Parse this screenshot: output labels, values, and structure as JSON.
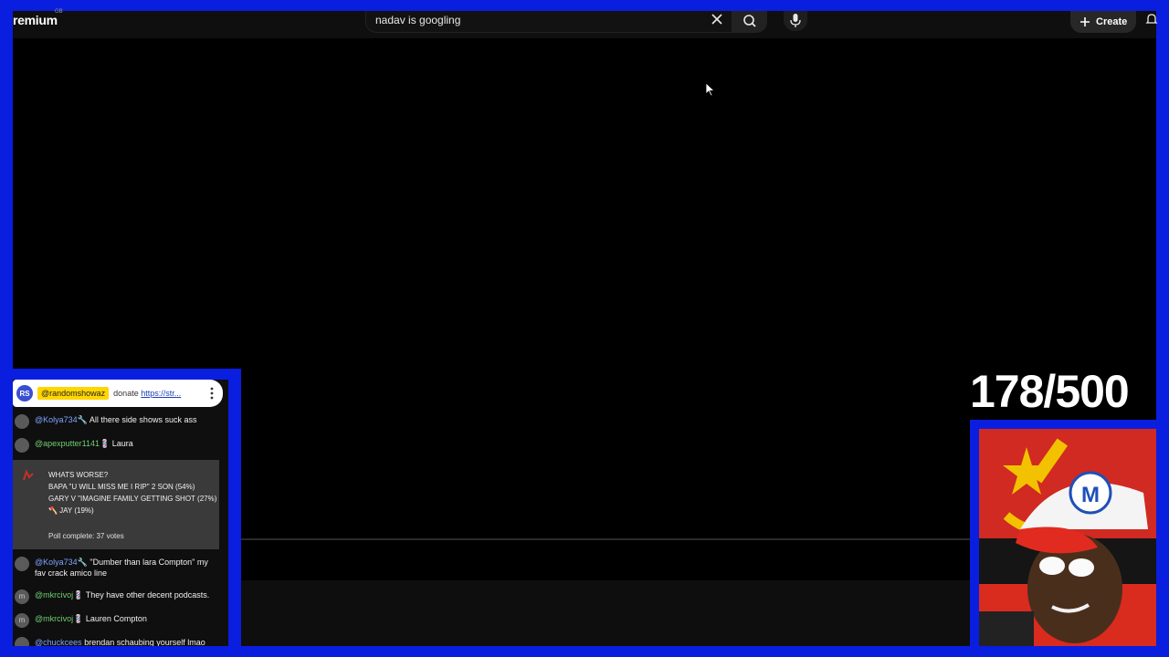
{
  "header": {
    "logo_text": "remium",
    "logo_sup": "GB",
    "search_value": "nadav is googling",
    "create_label": "Create"
  },
  "chat": {
    "pinned": {
      "avatar": "RS",
      "user": "@randomshowaz",
      "message": "donate ",
      "link": "https://str..."
    },
    "messages_top": [
      {
        "avatar": "",
        "user": "@Kolya734",
        "badge": "🔧",
        "text": "All there side shows suck ass"
      },
      {
        "avatar": "",
        "user": "@apexputter1141",
        "badge": "💈",
        "text": "Laura"
      }
    ],
    "poll": {
      "title": "WHATS WORSE?",
      "options": [
        "BAPA \"U WILL MISS ME I RIP\" 2 SON (54%)",
        "GARY V \"IMAGINE FAMILY GETTING SHOT (27%)",
        "🪓 JAY (19%)"
      ],
      "footer": "Poll complete: 37 votes"
    },
    "messages_bottom": [
      {
        "avatar": "",
        "user": "@Kolya734",
        "badge": "🔧",
        "text": "\"Dumber than lara Compton\" my fav crack amico line"
      },
      {
        "avatar": "m",
        "user": "@mkrcivoj",
        "badge": "💈",
        "text": "They have other decent podcasts."
      },
      {
        "avatar": "m",
        "user": "@mkrcivoj",
        "badge": "💈",
        "text": "Lauren Compton"
      },
      {
        "avatar": "",
        "user": "@chuckcees",
        "badge": "",
        "text": "brendan schaubing yourself lmao"
      }
    ]
  },
  "counter": "178/500",
  "colors": {
    "frame": "#0a1ee0",
    "background": "#000000"
  }
}
